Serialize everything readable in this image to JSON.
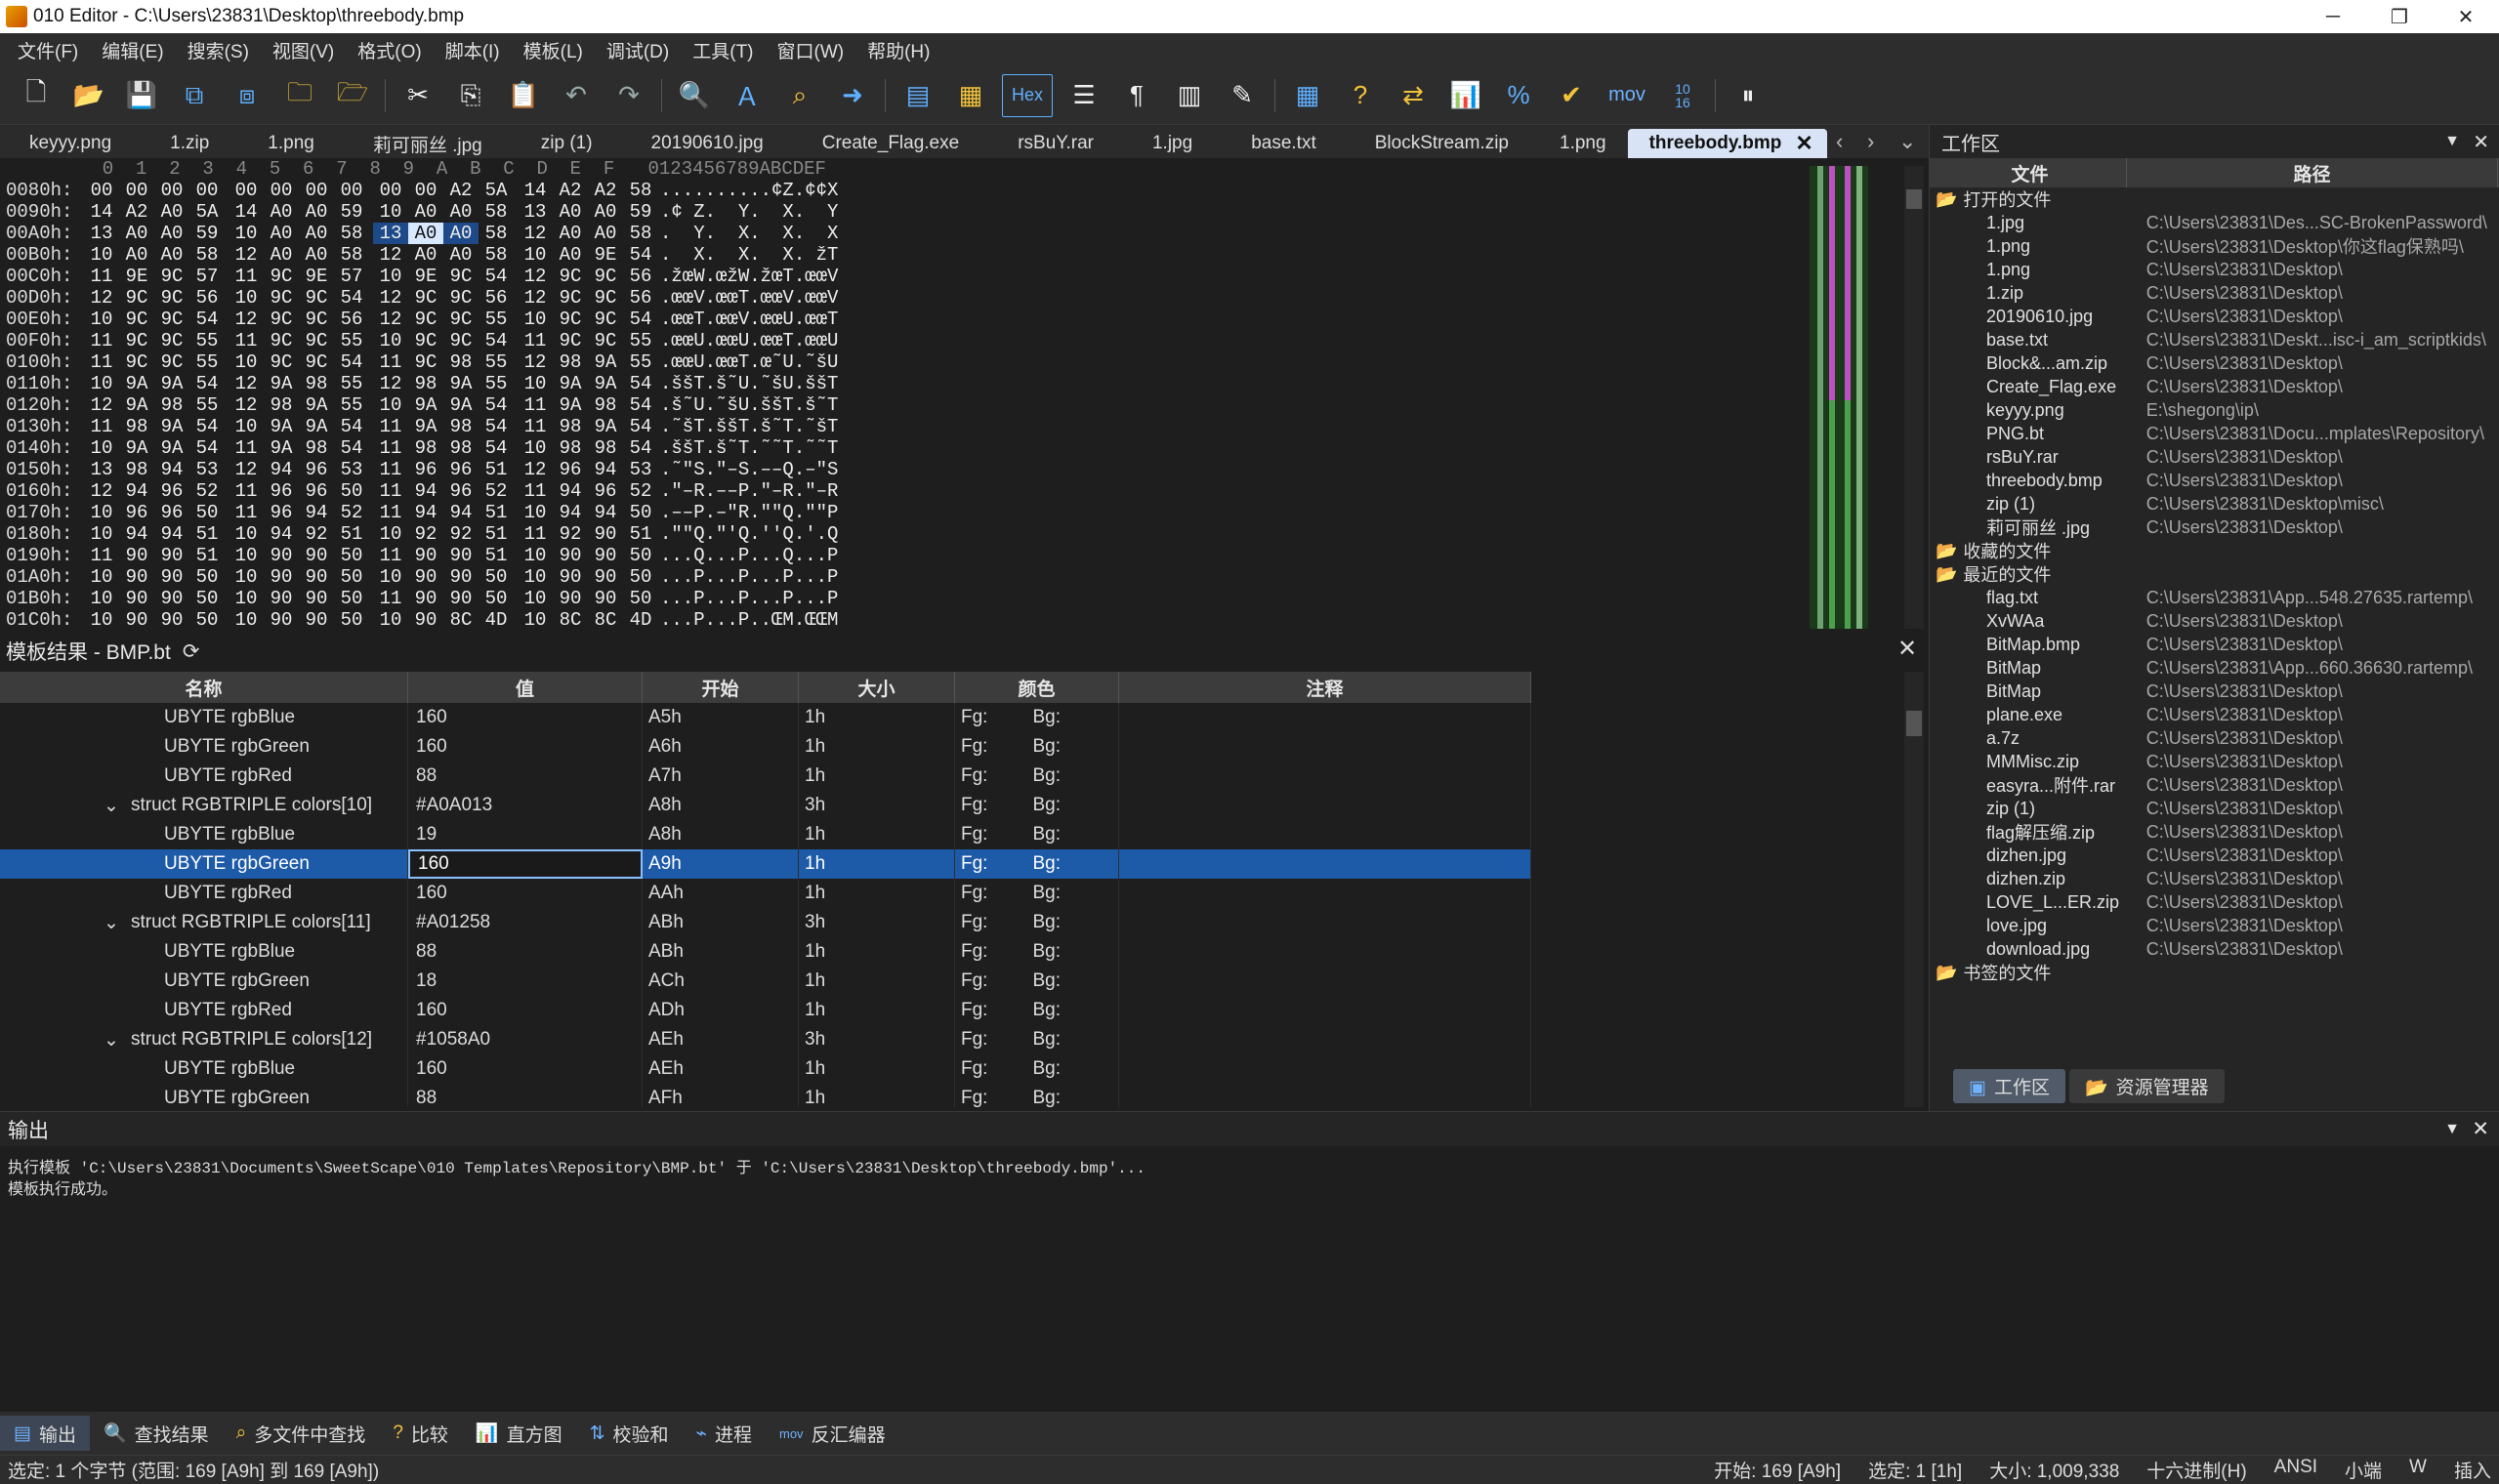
{
  "window": {
    "title": "010 Editor - C:\\Users\\23831\\Desktop\\threebody.bmp",
    "min": "─",
    "max": "❐",
    "close": "✕"
  },
  "menu": [
    "文件(F)",
    "编辑(E)",
    "搜索(S)",
    "视图(V)",
    "格式(O)",
    "脚本(I)",
    "模板(L)",
    "调试(D)",
    "工具(T)",
    "窗口(W)",
    "帮助(H)"
  ],
  "toolbar": {
    "hex_label": "Hex",
    "mov_label": "mov",
    "num_label": "10\n16"
  },
  "tabs": [
    "keyyy.png",
    "1.zip",
    "1.png",
    "莉可丽丝 .jpg",
    "zip (1)",
    "20190610.jpg",
    "Create_Flag.exe",
    "rsBuY.rar",
    "1.jpg",
    "base.txt",
    "BlockStream.zip",
    "1.png"
  ],
  "active_tab": "threebody.bmp",
  "hex": {
    "header": "  0  1  2  3  4  5  6  7  8  9  A  B  C  D  E  F   0123456789ABCDEF",
    "rows": [
      {
        "addr": "0080h:",
        "bytes": [
          "00",
          "00",
          "00",
          "00",
          "00",
          "00",
          "00",
          "00",
          "00",
          "00",
          "A2",
          "5A",
          "14",
          "A2",
          "A2",
          "58"
        ],
        "ascii": "..........¢Z.¢¢X"
      },
      {
        "addr": "0090h:",
        "bytes": [
          "14",
          "A2",
          "A0",
          "5A",
          "14",
          "A0",
          "A0",
          "59",
          "10",
          "A0",
          "A0",
          "58",
          "13",
          "A0",
          "A0",
          "59"
        ],
        "ascii": ".¢ Z.  Y.  X.  Y"
      },
      {
        "addr": "00A0h:",
        "bytes": [
          "13",
          "A0",
          "A0",
          "59",
          "10",
          "A0",
          "A0",
          "58",
          "13",
          "A0",
          "A0",
          "58",
          "12",
          "A0",
          "A0",
          "58"
        ],
        "ascii": ".  Y.  X.  X.  X"
      },
      {
        "addr": "00B0h:",
        "bytes": [
          "10",
          "A0",
          "A0",
          "58",
          "12",
          "A0",
          "A0",
          "58",
          "12",
          "A0",
          "A0",
          "58",
          "10",
          "A0",
          "9E",
          "54"
        ],
        "ascii": ".  X.  X.  X. žT"
      },
      {
        "addr": "00C0h:",
        "bytes": [
          "11",
          "9E",
          "9C",
          "57",
          "11",
          "9C",
          "9E",
          "57",
          "10",
          "9E",
          "9C",
          "54",
          "12",
          "9C",
          "9C",
          "56"
        ],
        "ascii": ".žœW.œžW.žœT.œœV"
      },
      {
        "addr": "00D0h:",
        "bytes": [
          "12",
          "9C",
          "9C",
          "56",
          "10",
          "9C",
          "9C",
          "54",
          "12",
          "9C",
          "9C",
          "56",
          "12",
          "9C",
          "9C",
          "56"
        ],
        "ascii": ".œœV.œœT.œœV.œœV"
      },
      {
        "addr": "00E0h:",
        "bytes": [
          "10",
          "9C",
          "9C",
          "54",
          "12",
          "9C",
          "9C",
          "56",
          "12",
          "9C",
          "9C",
          "55",
          "10",
          "9C",
          "9C",
          "54"
        ],
        "ascii": ".œœT.œœV.œœU.œœT"
      },
      {
        "addr": "00F0h:",
        "bytes": [
          "11",
          "9C",
          "9C",
          "55",
          "11",
          "9C",
          "9C",
          "55",
          "10",
          "9C",
          "9C",
          "54",
          "11",
          "9C",
          "9C",
          "55"
        ],
        "ascii": ".œœU.œœU.œœT.œœU"
      },
      {
        "addr": "0100h:",
        "bytes": [
          "11",
          "9C",
          "9C",
          "55",
          "10",
          "9C",
          "9C",
          "54",
          "11",
          "9C",
          "98",
          "55",
          "12",
          "98",
          "9A",
          "55"
        ],
        "ascii": ".œœU.œœT.œ˜U.˜šU"
      },
      {
        "addr": "0110h:",
        "bytes": [
          "10",
          "9A",
          "9A",
          "54",
          "12",
          "9A",
          "98",
          "55",
          "12",
          "98",
          "9A",
          "55",
          "10",
          "9A",
          "9A",
          "54"
        ],
        "ascii": ".ššT.š˜U.˜šU.ššT"
      },
      {
        "addr": "0120h:",
        "bytes": [
          "12",
          "9A",
          "98",
          "55",
          "12",
          "98",
          "9A",
          "55",
          "10",
          "9A",
          "9A",
          "54",
          "11",
          "9A",
          "98",
          "54"
        ],
        "ascii": ".š˜U.˜šU.ššT.š˜T"
      },
      {
        "addr": "0130h:",
        "bytes": [
          "11",
          "98",
          "9A",
          "54",
          "10",
          "9A",
          "9A",
          "54",
          "11",
          "9A",
          "98",
          "54",
          "11",
          "98",
          "9A",
          "54"
        ],
        "ascii": ".˜šT.ššT.š˜T.˜šT"
      },
      {
        "addr": "0140h:",
        "bytes": [
          "10",
          "9A",
          "9A",
          "54",
          "11",
          "9A",
          "98",
          "54",
          "11",
          "98",
          "98",
          "54",
          "10",
          "98",
          "98",
          "54"
        ],
        "ascii": ".ššT.š˜T.˜˜T.˜˜T"
      },
      {
        "addr": "0150h:",
        "bytes": [
          "13",
          "98",
          "94",
          "53",
          "12",
          "94",
          "96",
          "53",
          "11",
          "96",
          "96",
          "51",
          "12",
          "96",
          "94",
          "53"
        ],
        "ascii": ".˜\"S.\"–S.––Q.–\"S"
      },
      {
        "addr": "0160h:",
        "bytes": [
          "12",
          "94",
          "96",
          "52",
          "11",
          "96",
          "96",
          "50",
          "11",
          "94",
          "96",
          "52",
          "11",
          "94",
          "96",
          "52"
        ],
        "ascii": ".\"–R.––P.\"–R.\"–R"
      },
      {
        "addr": "0170h:",
        "bytes": [
          "10",
          "96",
          "96",
          "50",
          "11",
          "96",
          "94",
          "52",
          "11",
          "94",
          "94",
          "51",
          "10",
          "94",
          "94",
          "50"
        ],
        "ascii": ".––P.–\"R.\"\"Q.\"\"P"
      },
      {
        "addr": "0180h:",
        "bytes": [
          "10",
          "94",
          "94",
          "51",
          "10",
          "94",
          "92",
          "51",
          "10",
          "92",
          "92",
          "51",
          "11",
          "92",
          "90",
          "51"
        ],
        "ascii": ".\"\"Q.\"'Q.''Q.'.Q"
      },
      {
        "addr": "0190h:",
        "bytes": [
          "11",
          "90",
          "90",
          "51",
          "10",
          "90",
          "90",
          "50",
          "11",
          "90",
          "90",
          "51",
          "10",
          "90",
          "90",
          "50"
        ],
        "ascii": "...Q...P...Q...P"
      },
      {
        "addr": "01A0h:",
        "bytes": [
          "10",
          "90",
          "90",
          "50",
          "10",
          "90",
          "90",
          "50",
          "10",
          "90",
          "90",
          "50",
          "10",
          "90",
          "90",
          "50"
        ],
        "ascii": "...P...P...P...P"
      },
      {
        "addr": "01B0h:",
        "bytes": [
          "10",
          "90",
          "90",
          "50",
          "10",
          "90",
          "90",
          "50",
          "11",
          "90",
          "90",
          "50",
          "10",
          "90",
          "90",
          "50"
        ],
        "ascii": "...P...P...P...P"
      },
      {
        "addr": "01C0h:",
        "bytes": [
          "10",
          "90",
          "90",
          "50",
          "10",
          "90",
          "90",
          "50",
          "10",
          "90",
          "8C",
          "4D",
          "10",
          "8C",
          "8C",
          "4D"
        ],
        "ascii": "...P...P..ŒM.ŒŒM"
      }
    ]
  },
  "template": {
    "title": "模板结果 - BMP.bt",
    "columns": [
      "名称",
      "值",
      "开始",
      "大小",
      "颜色",
      "注释"
    ],
    "rows": [
      {
        "name": "UBYTE rgbBlue",
        "value": "160",
        "start": "A5h",
        "size": "1h",
        "fg": "Fg:",
        "bg": "Bg:",
        "struct": false
      },
      {
        "name": "UBYTE rgbGreen",
        "value": "160",
        "start": "A6h",
        "size": "1h",
        "fg": "Fg:",
        "bg": "Bg:",
        "struct": false
      },
      {
        "name": "UBYTE rgbRed",
        "value": "88",
        "start": "A7h",
        "size": "1h",
        "fg": "Fg:",
        "bg": "Bg:",
        "struct": false
      },
      {
        "name": "struct RGBTRIPLE colors[10]",
        "value": "#A0A013",
        "start": "A8h",
        "size": "3h",
        "fg": "Fg:",
        "bg": "Bg:",
        "struct": true
      },
      {
        "name": "UBYTE rgbBlue",
        "value": "19",
        "start": "A8h",
        "size": "1h",
        "fg": "Fg:",
        "bg": "Bg:",
        "struct": false
      },
      {
        "name": "UBYTE rgbGreen",
        "value": "160",
        "start": "A9h",
        "size": "1h",
        "fg": "Fg:",
        "bg": "Bg:",
        "struct": false,
        "selected": true
      },
      {
        "name": "UBYTE rgbRed",
        "value": "160",
        "start": "AAh",
        "size": "1h",
        "fg": "Fg:",
        "bg": "Bg:",
        "struct": false
      },
      {
        "name": "struct RGBTRIPLE colors[11]",
        "value": "#A01258",
        "start": "ABh",
        "size": "3h",
        "fg": "Fg:",
        "bg": "Bg:",
        "struct": true
      },
      {
        "name": "UBYTE rgbBlue",
        "value": "88",
        "start": "ABh",
        "size": "1h",
        "fg": "Fg:",
        "bg": "Bg:",
        "struct": false
      },
      {
        "name": "UBYTE rgbGreen",
        "value": "18",
        "start": "ACh",
        "size": "1h",
        "fg": "Fg:",
        "bg": "Bg:",
        "struct": false
      },
      {
        "name": "UBYTE rgbRed",
        "value": "160",
        "start": "ADh",
        "size": "1h",
        "fg": "Fg:",
        "bg": "Bg:",
        "struct": false
      },
      {
        "name": "struct RGBTRIPLE colors[12]",
        "value": "#1058A0",
        "start": "AEh",
        "size": "3h",
        "fg": "Fg:",
        "bg": "Bg:",
        "struct": true
      },
      {
        "name": "UBYTE rgbBlue",
        "value": "160",
        "start": "AEh",
        "size": "1h",
        "fg": "Fg:",
        "bg": "Bg:",
        "struct": false
      },
      {
        "name": "UBYTE rgbGreen",
        "value": "88",
        "start": "AFh",
        "size": "1h",
        "fg": "Fg:",
        "bg": "Bg:",
        "struct": false
      }
    ]
  },
  "workspace": {
    "title": "工作区",
    "columns": [
      "文件",
      "路径"
    ],
    "groups": [
      {
        "label": "打开的文件",
        "items": [
          [
            "1.jpg",
            "C:\\Users\\23831\\Des...SC-BrokenPassword\\"
          ],
          [
            "1.png",
            "C:\\Users\\23831\\Desktop\\你这flag保熟吗\\"
          ],
          [
            "1.png",
            "C:\\Users\\23831\\Desktop\\"
          ],
          [
            "1.zip",
            "C:\\Users\\23831\\Desktop\\"
          ],
          [
            "20190610.jpg",
            "C:\\Users\\23831\\Desktop\\"
          ],
          [
            "base.txt",
            "C:\\Users\\23831\\Deskt...isc-i_am_scriptkids\\"
          ],
          [
            "Block&...am.zip",
            "C:\\Users\\23831\\Desktop\\"
          ],
          [
            "Create_Flag.exe",
            "C:\\Users\\23831\\Desktop\\"
          ],
          [
            "keyyy.png",
            "E:\\shegong\\ip\\"
          ],
          [
            "PNG.bt",
            "C:\\Users\\23831\\Docu...mplates\\Repository\\"
          ],
          [
            "rsBuY.rar",
            "C:\\Users\\23831\\Desktop\\"
          ],
          [
            "threebody.bmp",
            "C:\\Users\\23831\\Desktop\\"
          ],
          [
            "zip (1)",
            "C:\\Users\\23831\\Desktop\\misc\\"
          ],
          [
            "莉可丽丝 .jpg",
            "C:\\Users\\23831\\Desktop\\"
          ]
        ]
      },
      {
        "label": "收藏的文件",
        "items": []
      },
      {
        "label": "最近的文件",
        "items": [
          [
            "flag.txt",
            "C:\\Users\\23831\\App...548.27635.rartemp\\"
          ],
          [
            "XvWAa",
            "C:\\Users\\23831\\Desktop\\"
          ],
          [
            "BitMap.bmp",
            "C:\\Users\\23831\\Desktop\\"
          ],
          [
            "BitMap",
            "C:\\Users\\23831\\App...660.36630.rartemp\\"
          ],
          [
            "BitMap",
            "C:\\Users\\23831\\Desktop\\"
          ],
          [
            "plane.exe",
            "C:\\Users\\23831\\Desktop\\"
          ],
          [
            "a.7z",
            "C:\\Users\\23831\\Desktop\\"
          ],
          [
            "MMMisc.zip",
            "C:\\Users\\23831\\Desktop\\"
          ],
          [
            "easyra...附件.rar",
            "C:\\Users\\23831\\Desktop\\"
          ],
          [
            "zip (1)",
            "C:\\Users\\23831\\Desktop\\"
          ],
          [
            "flag解压缩.zip",
            "C:\\Users\\23831\\Desktop\\"
          ],
          [
            "dizhen.jpg",
            "C:\\Users\\23831\\Desktop\\"
          ],
          [
            "dizhen.zip",
            "C:\\Users\\23831\\Desktop\\"
          ],
          [
            "LOVE_L...ER.zip",
            "C:\\Users\\23831\\Desktop\\"
          ],
          [
            "love.jpg",
            "C:\\Users\\23831\\Desktop\\"
          ],
          [
            "download.jpg",
            "C:\\Users\\23831\\Desktop\\"
          ]
        ]
      },
      {
        "label": "书签的文件",
        "items": []
      }
    ],
    "tabs": [
      "工作区",
      "资源管理器"
    ]
  },
  "output": {
    "title": "输出",
    "lines": [
      "执行模板 'C:\\Users\\23831\\Documents\\SweetScape\\010 Templates\\Repository\\BMP.bt' 于 'C:\\Users\\23831\\Desktop\\threebody.bmp'...",
      "模板执行成功。"
    ]
  },
  "bottom_tabs": [
    "输出",
    "查找结果",
    "多文件中查找",
    "比较",
    "直方图",
    "校验和",
    "进程",
    "反汇编器"
  ],
  "status": {
    "left": "选定: 1 个字节 (范围: 169 [A9h] 到 169 [A9h])",
    "start": "开始: 169 [A9h]",
    "sel": "选定: 1 [1h]",
    "size": "大小: 1,009,338",
    "mode": "十六进制(H)",
    "enc": "ANSI",
    "endian": "小端",
    "w": "W",
    "ins": "插入"
  }
}
